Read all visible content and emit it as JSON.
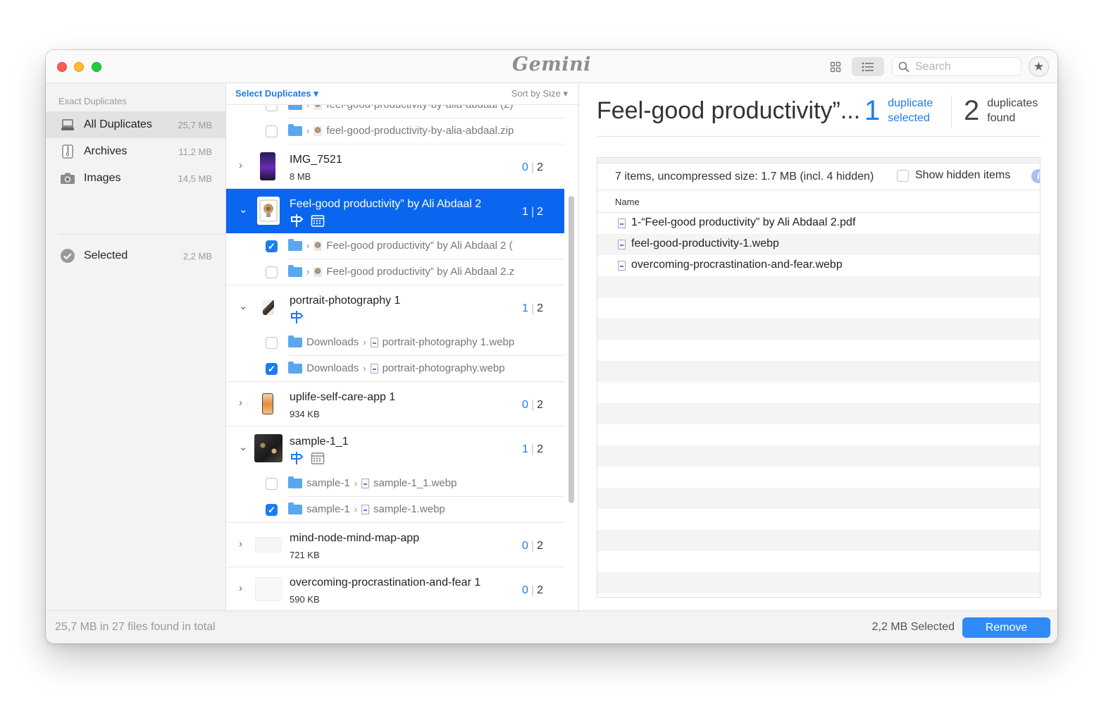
{
  "window": {
    "logo": "Gemini",
    "search_placeholder": "Search"
  },
  "sidebar": {
    "heading": "Exact Duplicates",
    "items": [
      {
        "label": "All Duplicates",
        "size": "25,7 MB",
        "icon": "all-duplicates-icon",
        "active": true
      },
      {
        "label": "Archives",
        "size": "11,2 MB",
        "icon": "archive-icon",
        "active": false
      },
      {
        "label": "Images",
        "size": "14,5 MB",
        "icon": "camera-icon",
        "active": false
      }
    ],
    "selected": {
      "label": "Selected",
      "size": "2,2 MB",
      "icon": "check-circle-icon"
    }
  },
  "list": {
    "select_duplicates": "Select Duplicates",
    "sort_by": "Sort by Size",
    "rows": [
      {
        "kind": "sub",
        "checked": false,
        "file_icon": "zip",
        "file": "feel-good-productivity-by-alia-abdaal (2)"
      },
      {
        "kind": "sub",
        "checked": false,
        "file_icon": "zip",
        "file": "feel-good-productivity-by-alia-abdaal.zip"
      },
      {
        "kind": "group",
        "expanded": false,
        "selected": false,
        "thumb": "phone-screenshot",
        "name": "IMG_7521",
        "size": "8 MB",
        "sel": "0",
        "total": "2"
      },
      {
        "kind": "group",
        "expanded": true,
        "selected": true,
        "thumb": "zip-archive",
        "name": "Feel-good productivity” by Ali Abdaal 2",
        "icons": [
          "auto-select-icon",
          "calendar-icon"
        ],
        "sel": "1",
        "total": "2"
      },
      {
        "kind": "sub",
        "checked": true,
        "file_icon": "zip",
        "file": "Feel-good productivity” by Ali Abdaal 2 ("
      },
      {
        "kind": "sub",
        "checked": false,
        "file_icon": "zip",
        "file": "Feel-good productivity” by Ali Abdaal 2.z"
      },
      {
        "kind": "group",
        "expanded": true,
        "selected": false,
        "thumb": "portrait-photo",
        "name": "portrait-photography 1",
        "icons": [
          "auto-select-icon"
        ],
        "sel": "1",
        "total": "2"
      },
      {
        "kind": "sub",
        "checked": false,
        "folder": "Downloads",
        "file_icon": "file",
        "file": "portrait-photography 1.webp"
      },
      {
        "kind": "sub",
        "checked": true,
        "folder": "Downloads",
        "file_icon": "file",
        "file": "portrait-photography.webp"
      },
      {
        "kind": "group",
        "expanded": false,
        "selected": false,
        "thumb": "app-screenshot",
        "name": "uplife-self-care-app 1",
        "size": "934 KB",
        "sel": "0",
        "total": "2"
      },
      {
        "kind": "group",
        "expanded": true,
        "selected": false,
        "thumb": "city-night",
        "name": "sample-1_1",
        "icons": [
          "auto-select-icon",
          "calendar-icon"
        ],
        "sel": "1",
        "total": "2"
      },
      {
        "kind": "sub",
        "checked": false,
        "folder": "sample-1",
        "file_icon": "file",
        "file": "sample-1_1.webp"
      },
      {
        "kind": "sub",
        "checked": true,
        "folder": "sample-1",
        "file_icon": "file",
        "file": "sample-1.webp"
      },
      {
        "kind": "group",
        "expanded": false,
        "selected": false,
        "thumb": "mind-map",
        "name": "mind-node-mind-map-app",
        "size": "721 KB",
        "sel": "0",
        "total": "2"
      },
      {
        "kind": "group",
        "expanded": false,
        "selected": false,
        "thumb": "diagram",
        "name": "overcoming-procrastination-and-fear 1",
        "size": "590 KB",
        "sel": "0",
        "total": "2"
      }
    ]
  },
  "detail": {
    "title": "Feel-good productivity”...",
    "selected_count": "1",
    "selected_label": "duplicate selected",
    "found_count": "2",
    "found_label": "duplicates found",
    "summary": "7 items, uncompressed size: 1.7 MB (incl. 4 hidden)",
    "show_hidden_label": "Show hidden items",
    "column_name": "Name",
    "files": [
      "1-“Feel-good productivity” by Ali Abdaal 2.pdf",
      "feel-good-productivity-1.webp",
      "overcoming-procrastination-and-fear.webp"
    ]
  },
  "footer": {
    "total": "25,7 MB in 27 files found in total",
    "selected": "2,2 MB Selected",
    "remove": "Remove"
  },
  "colors": {
    "accent": "#1d7bf3",
    "selected_row": "#0a66ee",
    "remove_button": "#2f8bf7"
  }
}
